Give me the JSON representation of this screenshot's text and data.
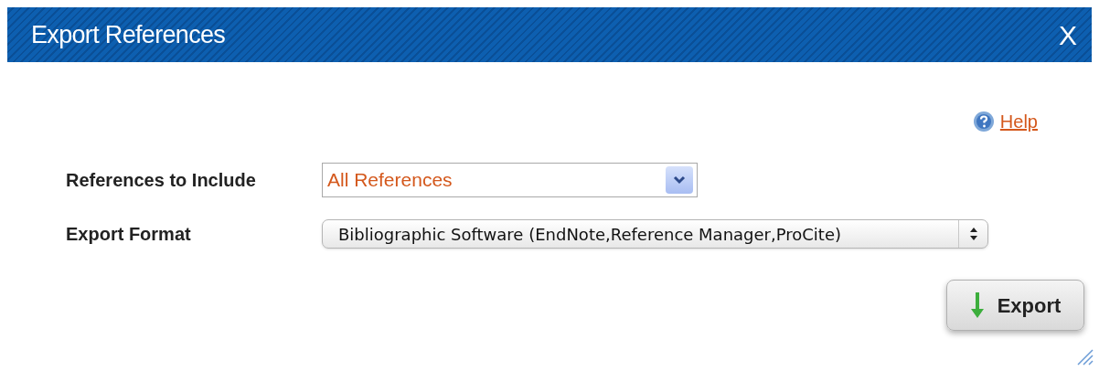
{
  "window": {
    "title": "Export References",
    "close": "X"
  },
  "help": {
    "label": "Help"
  },
  "fields": [
    {
      "label": "References to Include",
      "kind": "dropdown",
      "value": "All References"
    },
    {
      "label": "Export Format",
      "kind": "popup",
      "value": "Bibliographic Software (EndNote,Reference Manager,ProCite)"
    }
  ],
  "buttons": [
    {
      "label": "Export"
    }
  ]
}
